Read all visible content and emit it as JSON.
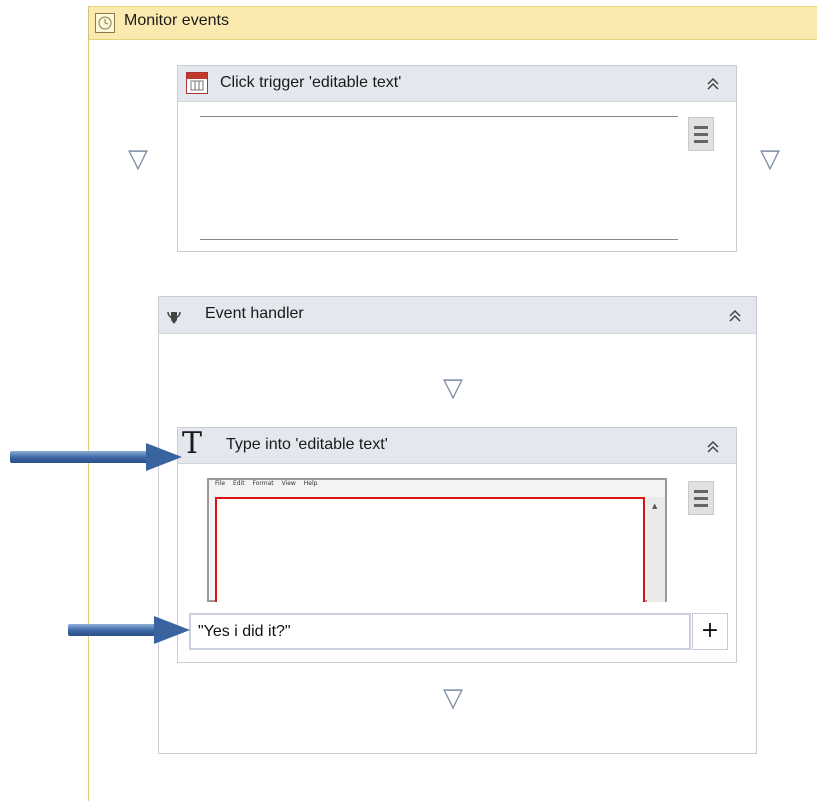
{
  "monitor": {
    "title": "Monitor events",
    "icon": "clock-icon"
  },
  "trigger": {
    "title": "Click trigger 'editable text'",
    "icon": "calendar-trigger-icon",
    "collapse_glyph": "≪"
  },
  "handler": {
    "title": "Event handler",
    "icon": "event-handler-icon",
    "icon_glyph": "⟲",
    "collapse_glyph": "≪"
  },
  "typeinto": {
    "title": "Type into 'editable text'",
    "icon": "text-T-icon",
    "icon_glyph": "T",
    "collapse_glyph": "≪",
    "screenshot_menu": [
      "File",
      "Edit",
      "Format",
      "View",
      "Help"
    ],
    "input_value": "\"Yes i did it?\"",
    "plus_label": "+"
  },
  "drop_glyph": "▽",
  "colors": {
    "monitor_header": "#fbeab0",
    "activity_header": "#e4e7ed",
    "arrow": "#3a64a0",
    "thumb_highlight": "#d11111"
  }
}
